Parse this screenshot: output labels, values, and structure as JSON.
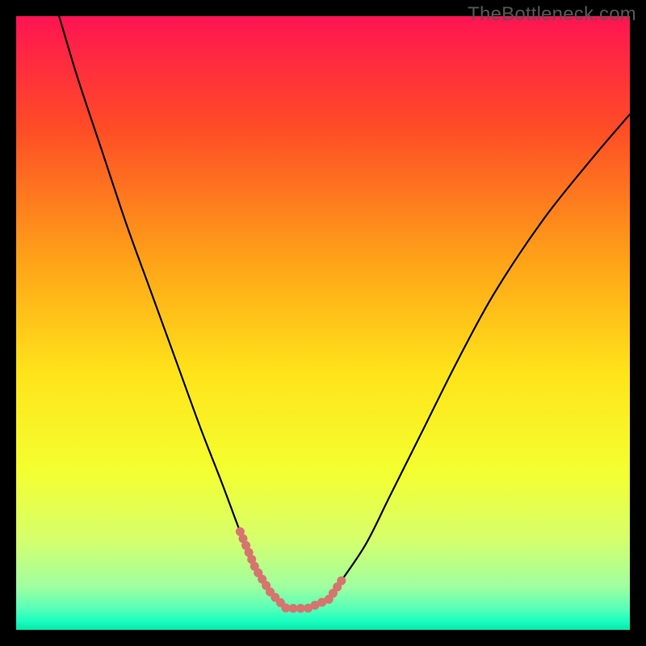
{
  "watermark": "TheBottleneck.com",
  "colors": {
    "background": "#000000",
    "curve": "#000000",
    "flat_segment": "#d6746f",
    "gradient_stops": [
      {
        "offset": 0.0,
        "color": "#ff1452"
      },
      {
        "offset": 0.18,
        "color": "#ff4b26"
      },
      {
        "offset": 0.4,
        "color": "#ffa318"
      },
      {
        "offset": 0.58,
        "color": "#ffe31a"
      },
      {
        "offset": 0.74,
        "color": "#f4ff2f"
      },
      {
        "offset": 0.85,
        "color": "#d7ff6a"
      },
      {
        "offset": 0.93,
        "color": "#9fffa0"
      },
      {
        "offset": 0.965,
        "color": "#58ffb7"
      },
      {
        "offset": 0.985,
        "color": "#1cffc0"
      },
      {
        "offset": 1.0,
        "color": "#06e8a8"
      }
    ]
  },
  "chart_data": {
    "type": "line",
    "title": "",
    "xlabel": "",
    "ylabel": "",
    "xlim": [
      0,
      100
    ],
    "ylim": [
      0,
      100
    ],
    "grid": false,
    "series": [
      {
        "name": "bottleneck-curve",
        "x": [
          7,
          10,
          14,
          18,
          22,
          26,
          30,
          33.5,
          36.5,
          39,
          41.5,
          44,
          47.5,
          51,
          53,
          57,
          61,
          66,
          72,
          78,
          86,
          94,
          100
        ],
        "y": [
          100,
          90,
          78,
          66,
          55,
          44,
          33,
          24,
          16,
          10,
          6,
          3.5,
          3.5,
          5,
          8,
          14,
          22,
          32,
          44,
          55,
          67,
          77,
          84
        ]
      }
    ],
    "highlight_segment": {
      "name": "flat-minimum-dotted",
      "x_range": [
        36.5,
        53
      ],
      "y_approx": [
        16,
        3.5,
        3.5,
        8
      ],
      "style": "thick-dotted"
    }
  }
}
